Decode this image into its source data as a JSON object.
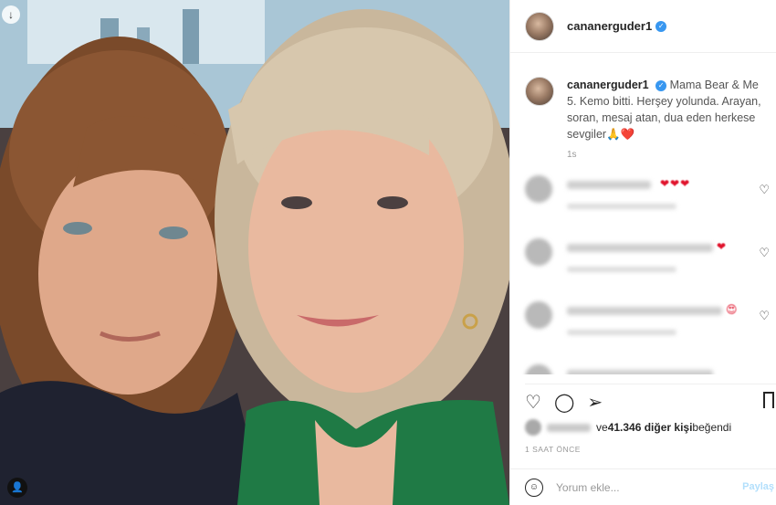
{
  "post": {
    "username": "cananerguder1",
    "caption": "Mama Bear & Me 5. Kemo bitti. Herşey yolunda. Arayan, soran, mesaj atan, dua eden herkese sevgiler🙏❤️",
    "caption_time": "1s",
    "likes_count_text": "ve 41.346 diğer kişi beğendi",
    "likes_prefix": "ve ",
    "likes_bold": "41.346 diğer kişi",
    "likes_suffix": " beğendi",
    "time_ago": "1 SAAT ÖNCE",
    "comment_placeholder": "Yorum ekle...",
    "post_label": "Paylaş"
  },
  "icons": {
    "download": "download-icon",
    "tag": "tag-people-icon",
    "verified": "verified-badge-icon",
    "like": "heart-outline-icon",
    "comment": "comment-bubble-icon",
    "share": "paper-plane-icon",
    "save": "bookmark-icon",
    "emoji": "emoji-smile-icon"
  },
  "colors": {
    "accent_blue": "#3897f0",
    "heart_red": "#e0122b",
    "muted_text": "#999999"
  },
  "comments": [
    {
      "hearts": "❤❤❤"
    },
    {
      "hearts": "❤"
    },
    {
      "hearts": "😍"
    },
    {
      "hearts": ""
    }
  ]
}
